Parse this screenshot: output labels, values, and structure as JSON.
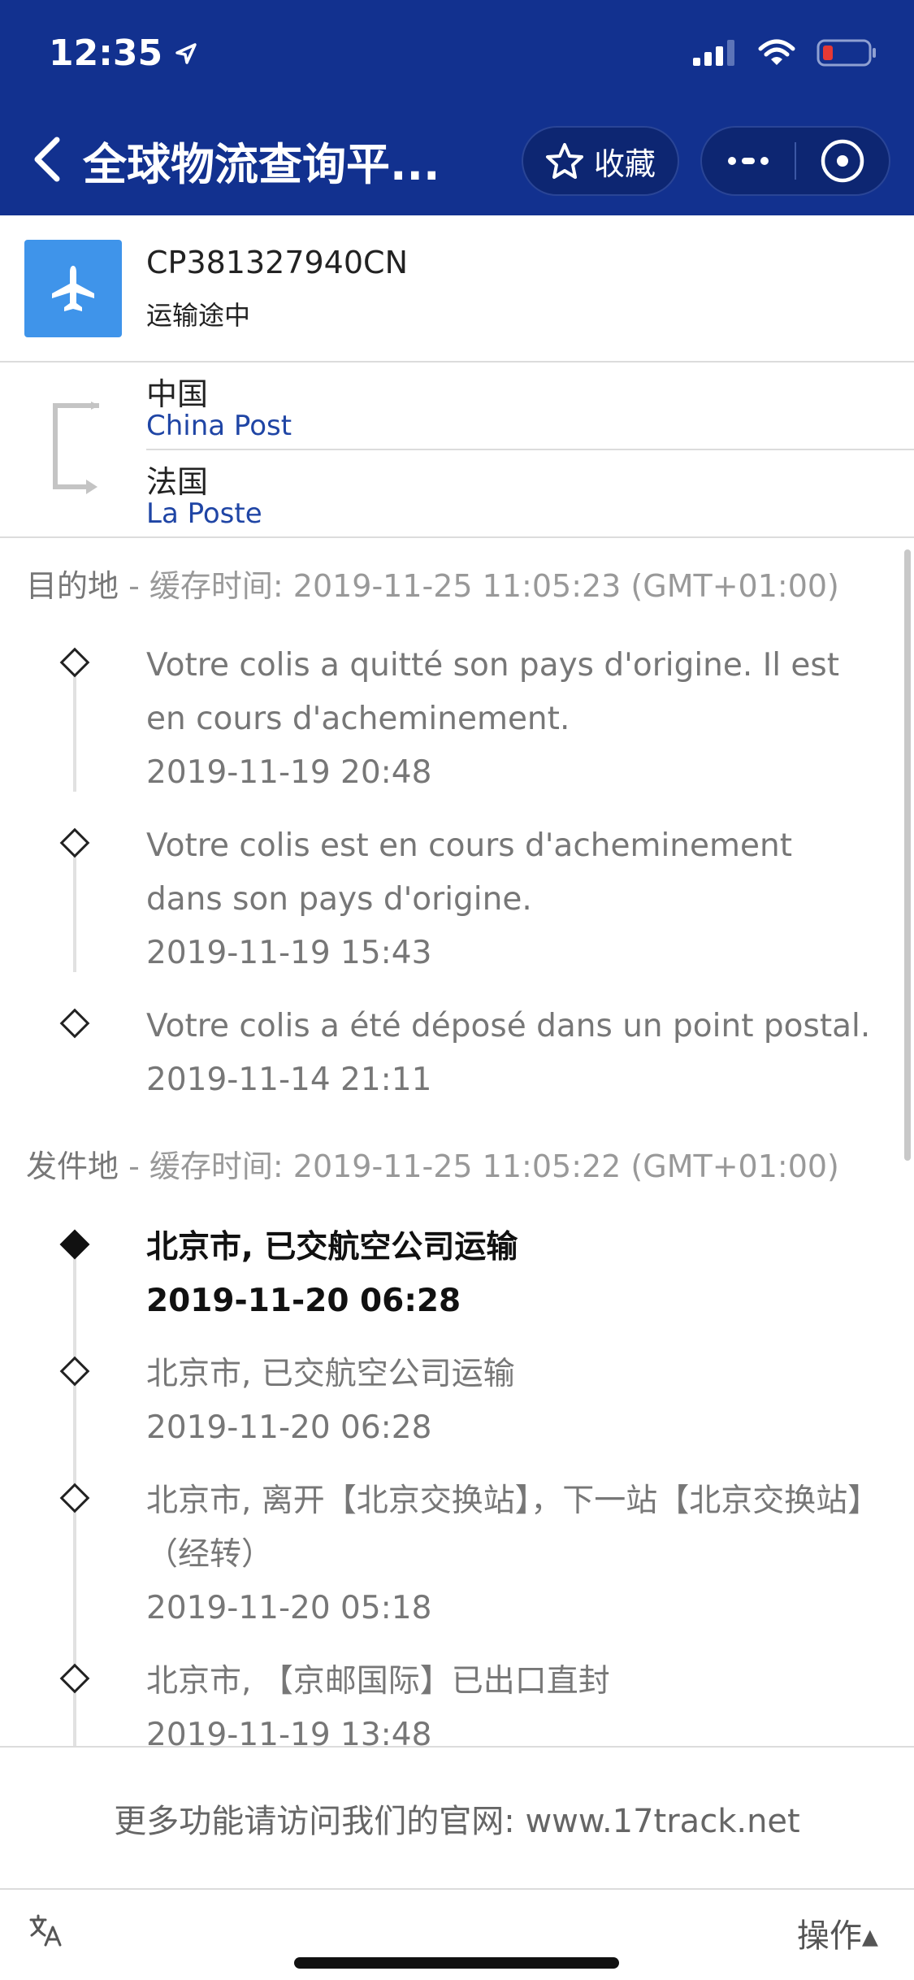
{
  "status_bar": {
    "time": "12:35"
  },
  "nav": {
    "title": "全球物流查询平...",
    "favorite_label": "收藏",
    "more_icon": "more-dots-icon",
    "close_icon": "close-circle-icon"
  },
  "colors": {
    "header_bg": "#12318f",
    "plane_box": "#3f94ea",
    "carrier_link": "#1f45a5"
  },
  "package": {
    "tracking_number": "CP381327940CN",
    "status": "运输途中"
  },
  "route": {
    "origin_country": "中国",
    "origin_carrier": "China Post",
    "dest_country": "法国",
    "dest_carrier": "La Poste"
  },
  "destination": {
    "label": "目的地",
    "cache_info": " - 缓存时间:  2019-11-25 11:05:23 (GMT+01:00)",
    "events": [
      {
        "text": "Votre colis a quitté son pays d'origine. Il est en cours d'acheminement.",
        "time": "2019-11-19 20:48"
      },
      {
        "text": "Votre colis est en cours d'acheminement dans son pays d'origine.",
        "time": "2019-11-19 15:43"
      },
      {
        "text": "Votre colis a été déposé dans un point postal.",
        "time": "2019-11-14 21:11"
      }
    ]
  },
  "origin": {
    "label": "发件地",
    "cache_info": " - 缓存时间:  2019-11-25 11:05:22 (GMT+01:00)",
    "events": [
      {
        "text": "北京市, 已交航空公司运输",
        "time": "2019-11-20 06:28"
      },
      {
        "text": "北京市, 已交航空公司运输",
        "time": "2019-11-20 06:28"
      },
      {
        "text": "北京市, 离开【北京交换站】，下一站【北京交换站】（经转）",
        "time": "2019-11-20 05:18"
      },
      {
        "text": "北京市, 【京邮国际】已出口直封",
        "time": "2019-11-19 13:48"
      }
    ]
  },
  "footer": {
    "note": "更多功能请访问我们的官网:  www.17track.net",
    "translate_icon": "translate-icon",
    "actions_label": "操作▴"
  }
}
